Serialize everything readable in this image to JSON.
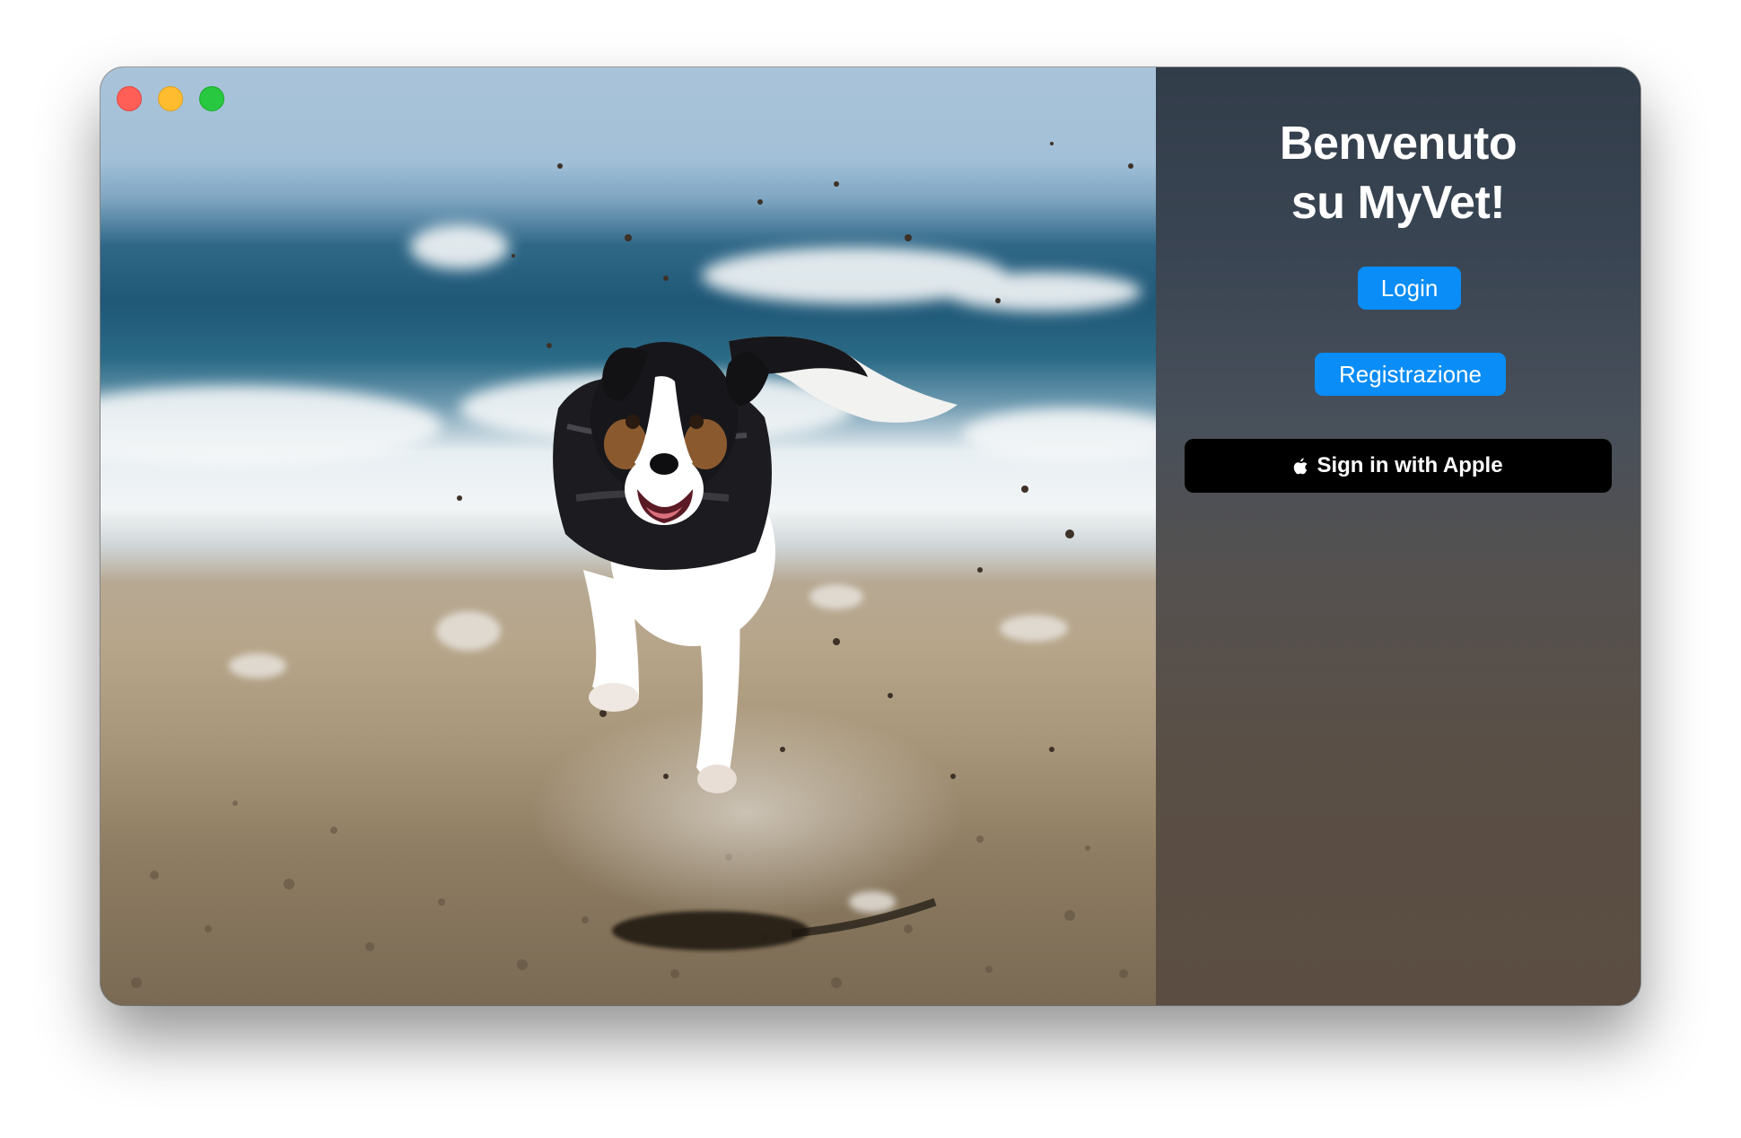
{
  "window": {
    "controls": {
      "close": "close-icon",
      "minimize": "minimize-icon",
      "zoom": "zoom-icon"
    }
  },
  "hero": {
    "image": "dog-running-on-beach-photo"
  },
  "welcome": {
    "title_line1": "Benvenuto",
    "title_line2": "su MyVet!"
  },
  "actions": {
    "login_label": "Login",
    "register_label": "Registrazione",
    "apple_label": "Sign in with Apple",
    "apple_icon": "apple-logo-icon"
  },
  "colors": {
    "accent": "#0a8df6",
    "apple_button": "#000000",
    "close": "#ff5f57",
    "minimize": "#febc2e",
    "zoom": "#28c840"
  }
}
